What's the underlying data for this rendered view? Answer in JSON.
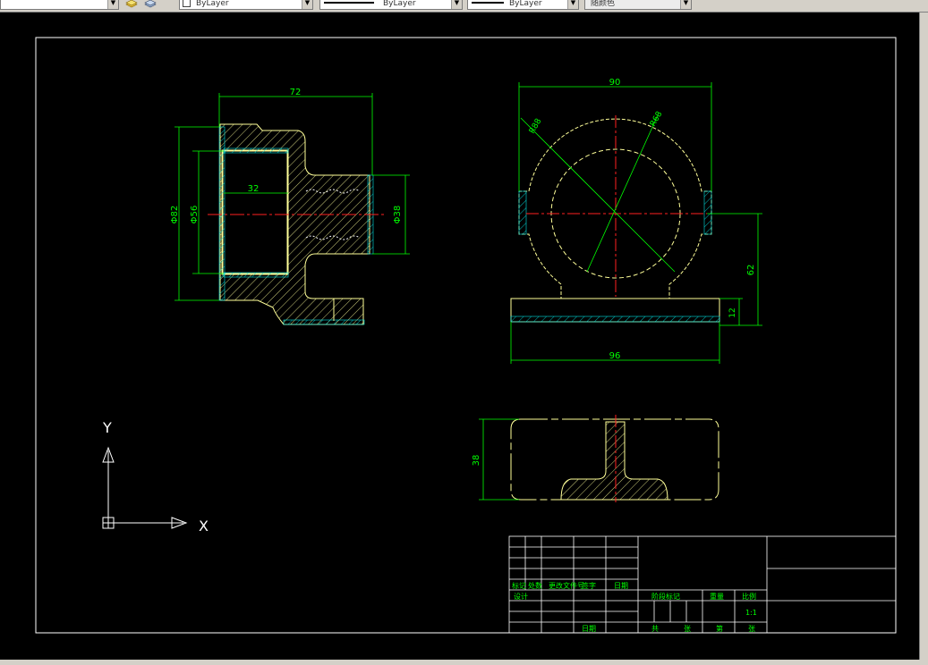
{
  "toolbar": {
    "layer_value": "ByLayer",
    "linetype_value": "ByLayer",
    "lineweight_value": "ByLayer",
    "plotstyle_value": "随颜色"
  },
  "colors": {
    "background": "#000000",
    "frame": "#ffffff",
    "outline": "#ffff99",
    "dimension": "#00ff00",
    "center_line": "#ff2020",
    "hatch": "#ffff99",
    "title_text": "#00ff00"
  },
  "drawing": {
    "front_view": {
      "dims": {
        "width": "72",
        "bore_depth": "32",
        "dia_outer": "Φ82",
        "dia_bore": "Φ56",
        "dia_boss": "Φ38"
      }
    },
    "side_view": {
      "dims": {
        "width_top": "90",
        "radius_outer": "R88",
        "radius_inner": "R68",
        "height": "62",
        "base_thickness": "12",
        "width_base": "96"
      }
    },
    "bottom_view": {
      "dims": {
        "height": "38"
      }
    },
    "ucs": {
      "x_label": "X",
      "y_label": "Y"
    }
  },
  "title_block": {
    "headers": [
      "标记",
      "处数",
      "更改文件号",
      "签字",
      "日期"
    ],
    "design_label": "设计",
    "stage_labels": [
      "阶段标记",
      "重量",
      "比例"
    ],
    "scale_value": "1:1",
    "footer_left": "日期",
    "sheet_total": [
      "共",
      "张"
    ],
    "sheet_num": [
      "第",
      "张"
    ]
  }
}
